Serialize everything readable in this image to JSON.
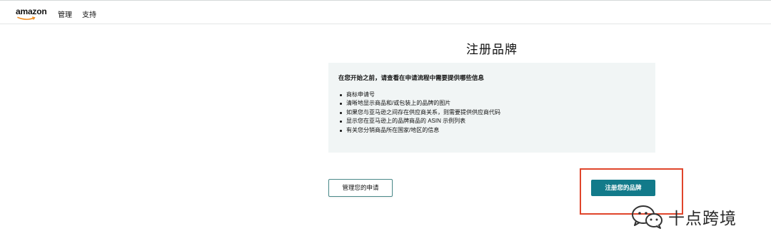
{
  "topbar": {
    "logo_text": "amazon",
    "nav": [
      "管理",
      "支持"
    ]
  },
  "page": {
    "title": "注册品牌"
  },
  "info": {
    "heading": "在您开始之前，请查看在申请流程中需要提供哪些信息",
    "items": [
      "商标申请号",
      "清晰地显示商品和/或包装上的品牌的图片",
      "如果您与亚马逊之间存在供应商关系，则需要提供供应商代码",
      "显示您在亚马逊上的品牌商品的 ASIN 示例列表",
      "有关您分销商品所在国家/地区的信息"
    ]
  },
  "buttons": {
    "manage_label": "管理您的申请",
    "register_label": "注册您的品牌"
  },
  "watermark": {
    "text": "十点跨境"
  },
  "colors": {
    "primary": "#127a8a",
    "panel_bg": "#f1f5f5",
    "highlight": "#e0452b"
  }
}
